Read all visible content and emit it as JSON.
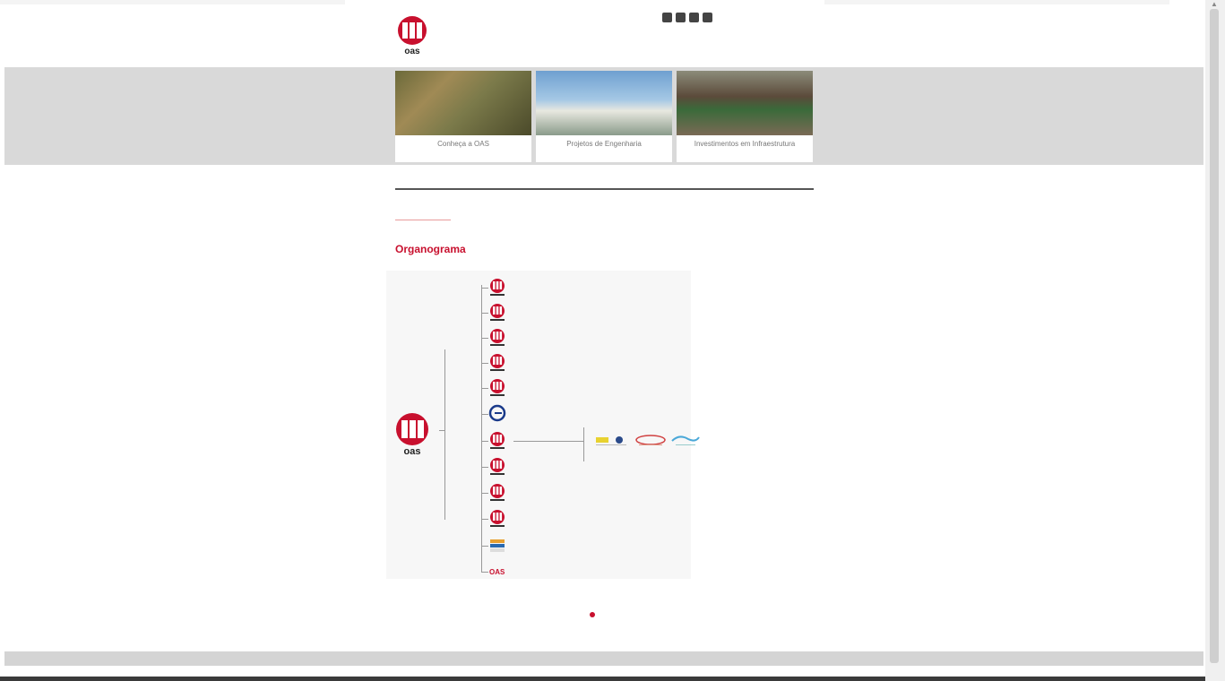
{
  "brand": {
    "logo_text": "oas"
  },
  "social": [
    "facebook-icon",
    "twitter-icon",
    "linkedin-icon",
    "youtube-icon"
  ],
  "language": "",
  "nav": [
    "",
    "",
    "",
    "",
    "",
    ""
  ],
  "tiles": [
    "Conheça a OAS",
    "Projetos de Engenharia",
    "Investimentos em Infraestrutura"
  ],
  "breadcrumb": [
    "",
    "",
    "",
    ""
  ],
  "subnav": [
    "",
    "",
    "",
    "",
    "",
    ""
  ],
  "page_title": "Organograma",
  "org": {
    "rows": [
      {
        "icon": "oas-logo-icon",
        "label": ""
      },
      {
        "icon": "oas-logo-icon",
        "label": ""
      },
      {
        "icon": "oas-logo-icon",
        "label": ""
      },
      {
        "icon": "oas-logo-icon",
        "label": ""
      },
      {
        "icon": "oas-logo-icon",
        "label": ""
      },
      {
        "icon": "blue-logo-icon",
        "label": ""
      },
      {
        "icon": "oas-logo-icon",
        "label": ""
      },
      {
        "icon": "oas-logo-icon",
        "label": ""
      },
      {
        "icon": "oas-logo-icon",
        "label": ""
      },
      {
        "icon": "oas-logo-icon",
        "label": ""
      },
      {
        "icon": "flag-logo-icon",
        "label": ""
      },
      {
        "icon": "text-logo-icon",
        "label": ""
      }
    ]
  },
  "pager": {
    "label": ""
  },
  "footer": {
    "text": ""
  },
  "colors": {
    "brand_red": "#c8102e",
    "band_gray": "#d9d9d9"
  }
}
